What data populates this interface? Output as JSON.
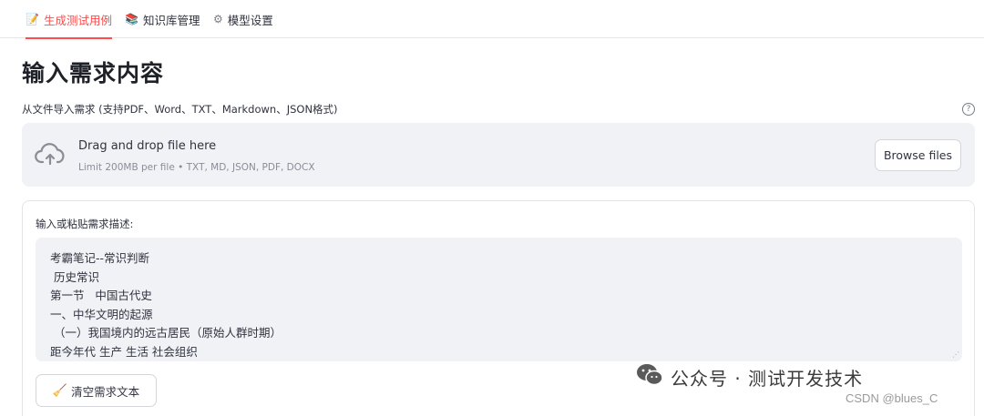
{
  "tabs": [
    {
      "icon": "memo-icon",
      "label": "生成测试用例",
      "active": true
    },
    {
      "icon": "books-icon",
      "label": "知识库管理",
      "active": false
    },
    {
      "icon": "gear-icon",
      "label": "模型设置",
      "active": false
    }
  ],
  "page_title": "输入需求内容",
  "uploader": {
    "label": "从文件导入需求 (支持PDF、Word、TXT、Markdown、JSON格式)",
    "help_glyph": "?",
    "drop_title": "Drag and drop file here",
    "drop_subtitle": "Limit 200MB per file • TXT, MD, JSON, PDF, DOCX",
    "browse_label": "Browse files"
  },
  "requirements": {
    "label": "输入或粘贴需求描述:",
    "lines": [
      "考霸笔记--常识判断",
      " 历史常识",
      "第一节   中国古代史",
      "一、中华文明的起源",
      " （一）我国境内的远古居民（原始人群时期）",
      "距今年代 生产 生活 社会组织"
    ],
    "clear_label": "清空需求文本"
  },
  "watermark": {
    "text": "公众号 · 测试开发技术",
    "sub": "CSDN @blues_C"
  },
  "colors": {
    "accent": "#ff4b4b",
    "panel_bg": "#f0f2f6",
    "text": "#31333f"
  }
}
